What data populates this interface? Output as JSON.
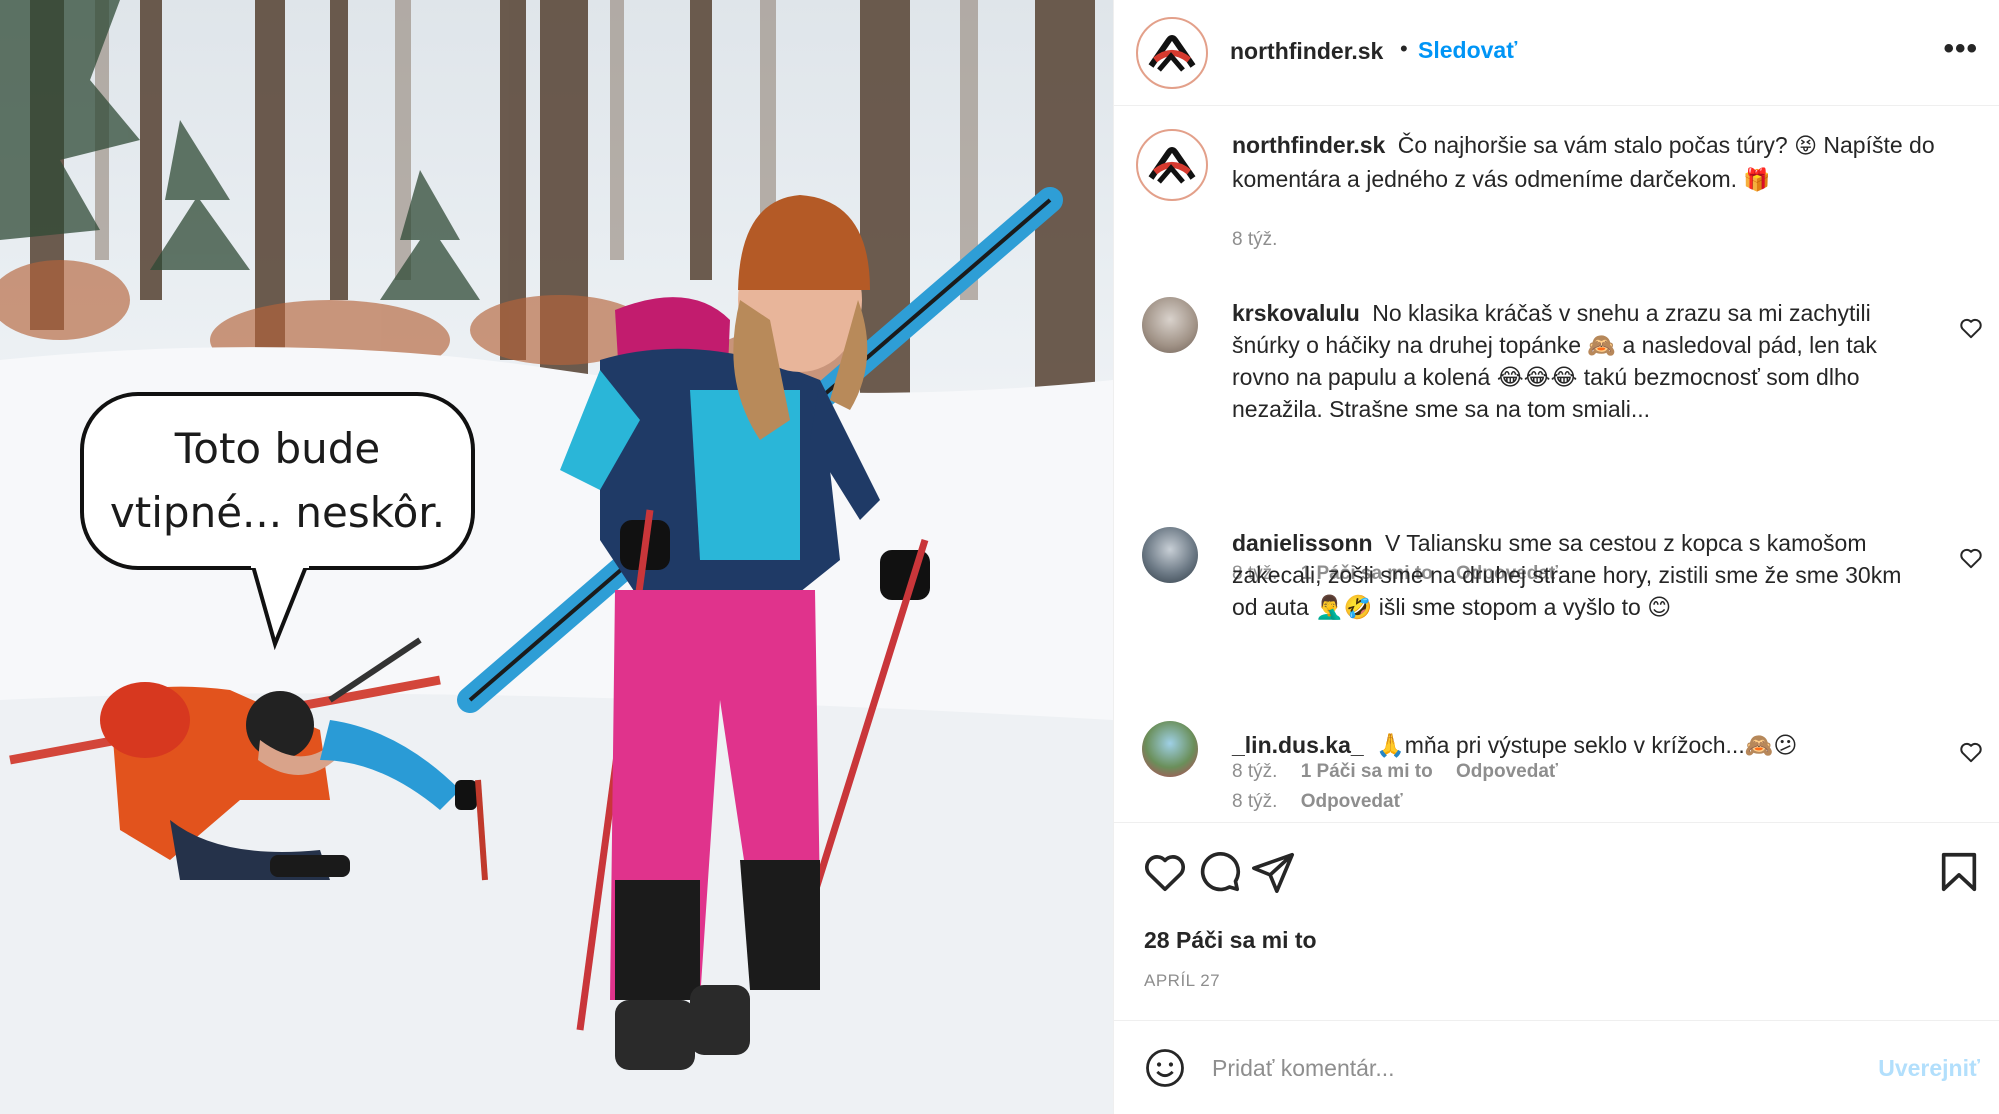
{
  "photo": {
    "bubble_line1": "Toto bude",
    "bubble_line2": "vtipné... neskôr."
  },
  "header": {
    "username": "northfinder.sk",
    "separator": "•",
    "follow_label": "Sledovať",
    "more_label": "•••"
  },
  "caption": {
    "username": "northfinder.sk",
    "text_part1": "Čo najhoršie sa vám stalo počas túry?",
    "emoji1": "😝",
    "text_part2": "Napíšte do komentára a jedného z vás odmeníme darčekom.",
    "emoji2": "🎁",
    "time": "8 týž."
  },
  "comments": [
    {
      "username": "krskovalulu",
      "text": "No klasika kráčaš v snehu a zrazu sa mi zachytili šnúrky o háčiky na druhej topánke 🙈 a nasledoval pád, len tak rovno na papulu a kolená 😂😂😂 takú bezmocnosť som dlho nezažila. Strašne sme sa na tom smiali...",
      "time": "8 týž.",
      "likes": "1 Páči sa mi to",
      "reply": "Odpovedať"
    },
    {
      "username": "danielissonn",
      "text": "V Taliansku sme sa cestou z kopca s kamošom zakecali, zošli sme na druhej strane hory, zistili sme že sme 30km od auta 🤦‍♂️🤣 išli sme stopom a vyšlo to 😊",
      "time": "8 týž.",
      "likes": "1 Páči sa mi to",
      "reply": "Odpovedať"
    },
    {
      "username": "_lin.dus.ka_",
      "text": "🙏mňa pri výstupe seklo v krížoch...🙈😕",
      "time": "8 týž.",
      "reply": "Odpovedať"
    }
  ],
  "actions": {
    "like_icon": "heart-icon",
    "comment_icon": "comment-icon",
    "share_icon": "send-icon",
    "save_icon": "bookmark-icon",
    "likes_count": "28 Páči sa mi to",
    "date": "APRÍL 27"
  },
  "add_comment": {
    "placeholder": "Pridať komentár...",
    "post_label": "Uverejniť"
  },
  "colors": {
    "accent": "#0095f6",
    "post_disabled": "#b2dffc",
    "muted": "#8e8e8e",
    "text": "#262626",
    "avatar_ring": "#e3a08a"
  }
}
